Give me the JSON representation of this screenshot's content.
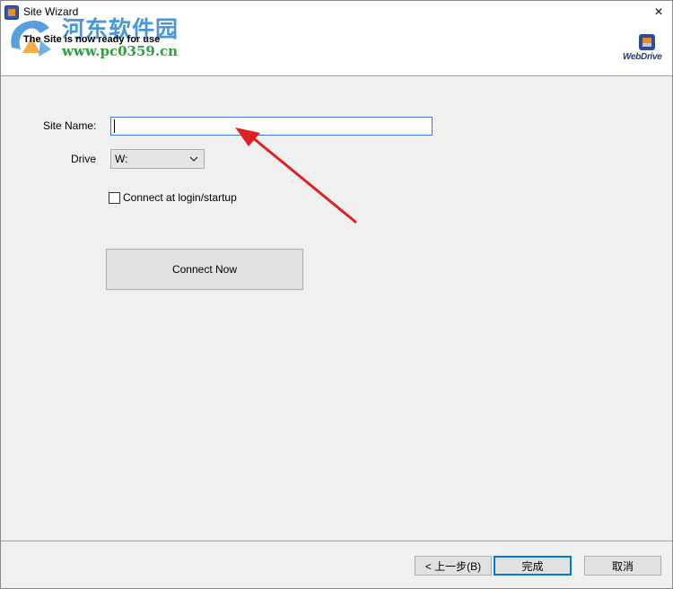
{
  "window": {
    "title": "Site Wizard",
    "subtitle": "The Site is now ready for use",
    "close_glyph": "×"
  },
  "watermark": {
    "name": "河东软件园",
    "url": "www.pc0359.cn"
  },
  "brand": {
    "name": "WebDrive"
  },
  "form": {
    "site_name_label": "Site Name:",
    "site_name_value": "",
    "drive_label": "Drive",
    "drive_value": "W:",
    "connect_checkbox_label": "Connect at login/startup",
    "connect_checkbox_checked": false,
    "connect_now_label": "Connect Now"
  },
  "footer": {
    "back_label": "< 上一步(B)",
    "finish_label": "完成",
    "cancel_label": "取消"
  },
  "colors": {
    "annotation_arrow": "#e02020",
    "focus_border": "#3b7ad9",
    "default_button_border": "#0078d7"
  }
}
